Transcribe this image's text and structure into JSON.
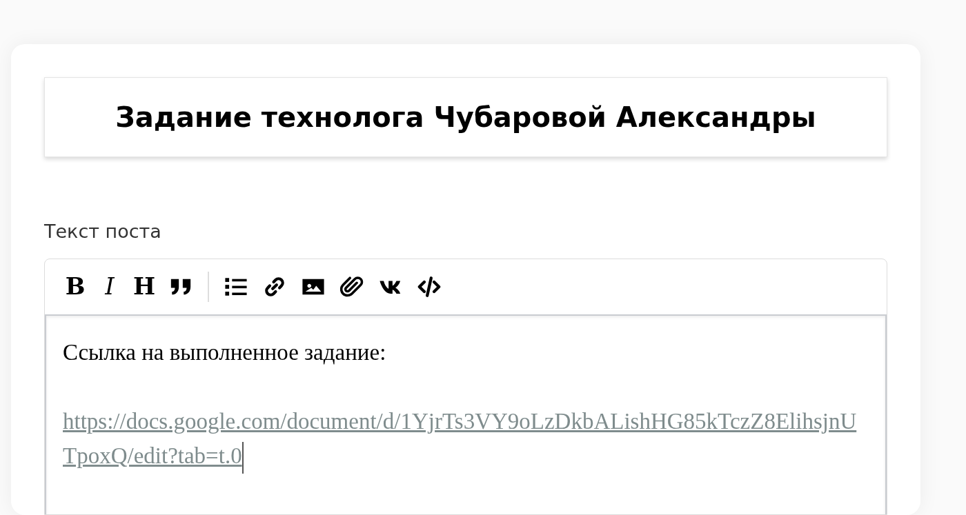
{
  "title": "Задание технолога Чубаровой Александры",
  "field_label": "Текст поста",
  "toolbar": [
    {
      "kind": "bold",
      "label": "B"
    },
    {
      "kind": "italic",
      "label": "I"
    },
    {
      "kind": "heading",
      "label": "H"
    },
    {
      "kind": "quote"
    },
    {
      "kind": "separator"
    },
    {
      "kind": "list"
    },
    {
      "kind": "link"
    },
    {
      "kind": "image"
    },
    {
      "kind": "attach"
    },
    {
      "kind": "vk"
    },
    {
      "kind": "code"
    }
  ],
  "editor": {
    "text": "Ссылка на выполненное задание:",
    "link": "https://docs.google.com/document/d/1YjrTs3VY9oLzDkbALishHG85kTczZ8ElihsjnUTpoxQ/edit?tab=t.0"
  }
}
